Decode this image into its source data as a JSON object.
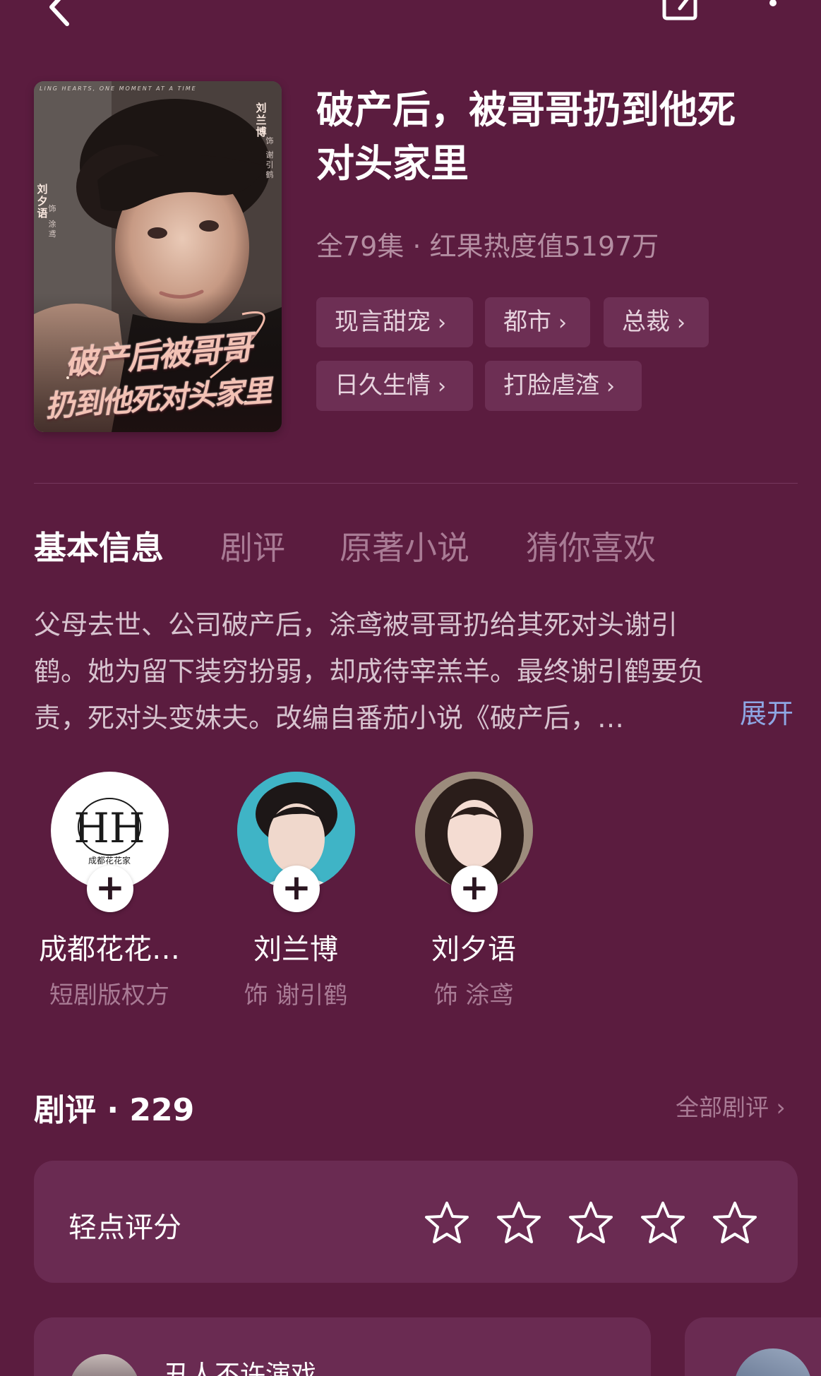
{
  "nav": {
    "back_icon": "chevron-left-icon",
    "share_icon": "share-icon",
    "more_icon": "more-vertical-icon"
  },
  "poster": {
    "tagline": "LING HEARTS, ONE MOMENT AT A TIME",
    "title_line1": "破产后被哥哥",
    "title_line2": "扔到他死对头家里",
    "actor1_name": "刘兰博",
    "actor1_role_prefix": "饰",
    "actor1_role": "谢引鹤",
    "actor2_name": "刘夕语",
    "actor2_role_prefix": "饰",
    "actor2_role": "涂鸢"
  },
  "drama": {
    "title_line1": "破产后，被哥哥扔到他死",
    "title_line2": "对头家里",
    "meta": "全79集 · 红果热度值5197万",
    "tags": [
      "现言甜宠",
      "都市",
      "总裁",
      "日久生情",
      "打脸虐渣"
    ],
    "tag_chevron": "›"
  },
  "tabs": [
    "基本信息",
    "剧评",
    "原著小说",
    "猜你喜欢"
  ],
  "synopsis": {
    "line1": "父母去世、公司破产后，涂鸢被哥哥扔给其死对头谢引",
    "line2": "鹤。她为留下装穷扮弱，却成待宰羔羊。最终谢引鹤要负",
    "line3": "责，死对头变妹夫。改编自番茄小说《破产后，…",
    "expand_label": "展开"
  },
  "cast": [
    {
      "name": "成都花花…",
      "role": "短剧版权方",
      "avatar_text": "HH",
      "avatar_subtext": "成都花花家"
    },
    {
      "name": "刘兰博",
      "role": "饰 谢引鹤"
    },
    {
      "name": "刘夕语",
      "role": "饰 涂鸢"
    }
  ],
  "cast_plus": "+",
  "reviews": {
    "heading": "剧评 · 229",
    "all_label": "全部剧评 ›",
    "rate_label": "轻点评分",
    "star_count": 5,
    "first_user": "丑人不许演戏"
  },
  "colors": {
    "background": "#5b1c3f",
    "card": "#6a2b52",
    "tag": "#6d2f54",
    "muted_text": "#a97b95",
    "link": "#8ea7e4"
  }
}
